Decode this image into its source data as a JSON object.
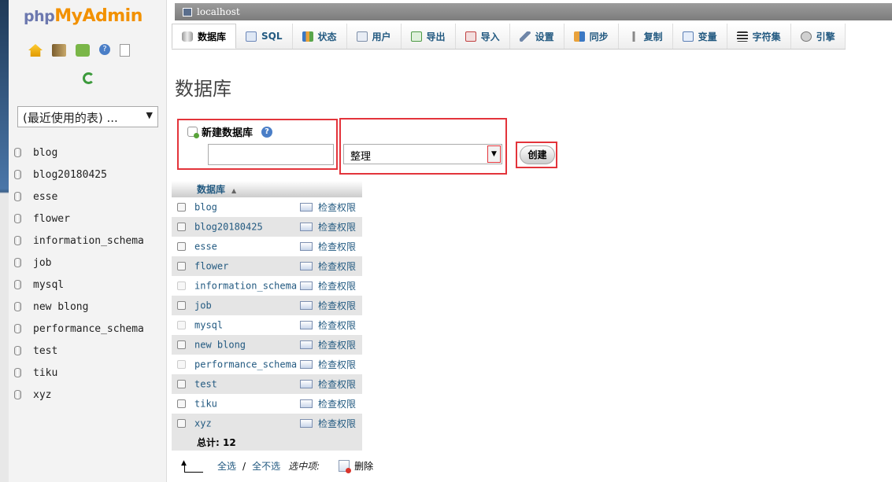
{
  "sidebar": {
    "logo": {
      "php": "php",
      "my": "My",
      "admin": "Admin"
    },
    "recent_select": "(最近使用的表) ...",
    "databases": [
      "blog",
      "blog20180425",
      "esse",
      "flower",
      "information_schema",
      "job",
      "mysql",
      "new blong",
      "performance_schema",
      "test",
      "tiku",
      "xyz"
    ]
  },
  "topbar": {
    "server": "localhost"
  },
  "tabs": [
    {
      "label": "数据库",
      "icon": "database-icon",
      "active": true
    },
    {
      "label": "SQL",
      "icon": "sql-icon"
    },
    {
      "label": "状态",
      "icon": "status-icon"
    },
    {
      "label": "用户",
      "icon": "users-icon"
    },
    {
      "label": "导出",
      "icon": "export-icon"
    },
    {
      "label": "导入",
      "icon": "import-icon"
    },
    {
      "label": "设置",
      "icon": "settings-icon"
    },
    {
      "label": "同步",
      "icon": "sync-icon"
    },
    {
      "label": "复制",
      "icon": "replication-icon"
    },
    {
      "label": "变量",
      "icon": "variables-icon"
    },
    {
      "label": "字符集",
      "icon": "charset-icon"
    },
    {
      "label": "引擎",
      "icon": "engine-icon"
    }
  ],
  "main": {
    "title": "数据库",
    "new_db_label": "新建数据库",
    "help": "?",
    "db_name_value": "",
    "collation_value": "整理",
    "create_label": "创建",
    "table": {
      "header_db": "数据库",
      "check_priv_label": "检查权限",
      "rows": [
        {
          "name": "blog",
          "disabled": false
        },
        {
          "name": "blog20180425",
          "disabled": false
        },
        {
          "name": "esse",
          "disabled": false
        },
        {
          "name": "flower",
          "disabled": false
        },
        {
          "name": "information_schema",
          "disabled": true
        },
        {
          "name": "job",
          "disabled": false
        },
        {
          "name": "mysql",
          "disabled": true
        },
        {
          "name": "new blong",
          "disabled": false
        },
        {
          "name": "performance_schema",
          "disabled": true
        },
        {
          "name": "test",
          "disabled": false
        },
        {
          "name": "tiku",
          "disabled": false
        },
        {
          "name": "xyz",
          "disabled": false
        }
      ],
      "total_label": "总计: 12"
    },
    "footer": {
      "select_all": "全选",
      "separator": "/",
      "deselect_all": "全不选",
      "with_selected": "选中项:",
      "delete": "删除"
    }
  },
  "colors": {
    "link": "#235a81",
    "highlight_box": "#e3343b"
  }
}
